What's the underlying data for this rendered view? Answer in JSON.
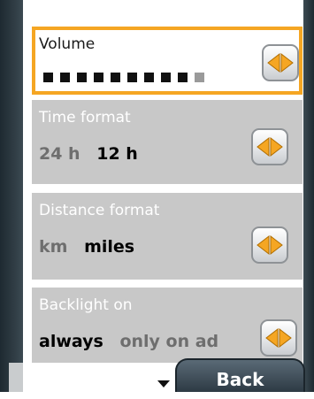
{
  "settings": {
    "volume": {
      "title": "Volume",
      "segments_total": 10,
      "segments_filled": 9
    },
    "time_format": {
      "title": "Time format",
      "options": [
        "24 h",
        "12 h"
      ],
      "selected_index": 1
    },
    "distance_format": {
      "title": "Distance format",
      "options": [
        "km",
        "miles"
      ],
      "selected_index": 1
    },
    "backlight": {
      "title": "Backlight on",
      "options": [
        "always",
        "only on ad"
      ],
      "selected_index": 0
    }
  },
  "footer": {
    "back_label": "Back"
  },
  "icons": {
    "arrow_button": "left-right-arrows-icon",
    "back_indicator": "triangle-down-icon"
  },
  "colors": {
    "selection_border": "#f5a623",
    "arrow_fill": "#f5a623",
    "panel_bg": "#c8c8c8",
    "frame": "#2d3a44"
  }
}
